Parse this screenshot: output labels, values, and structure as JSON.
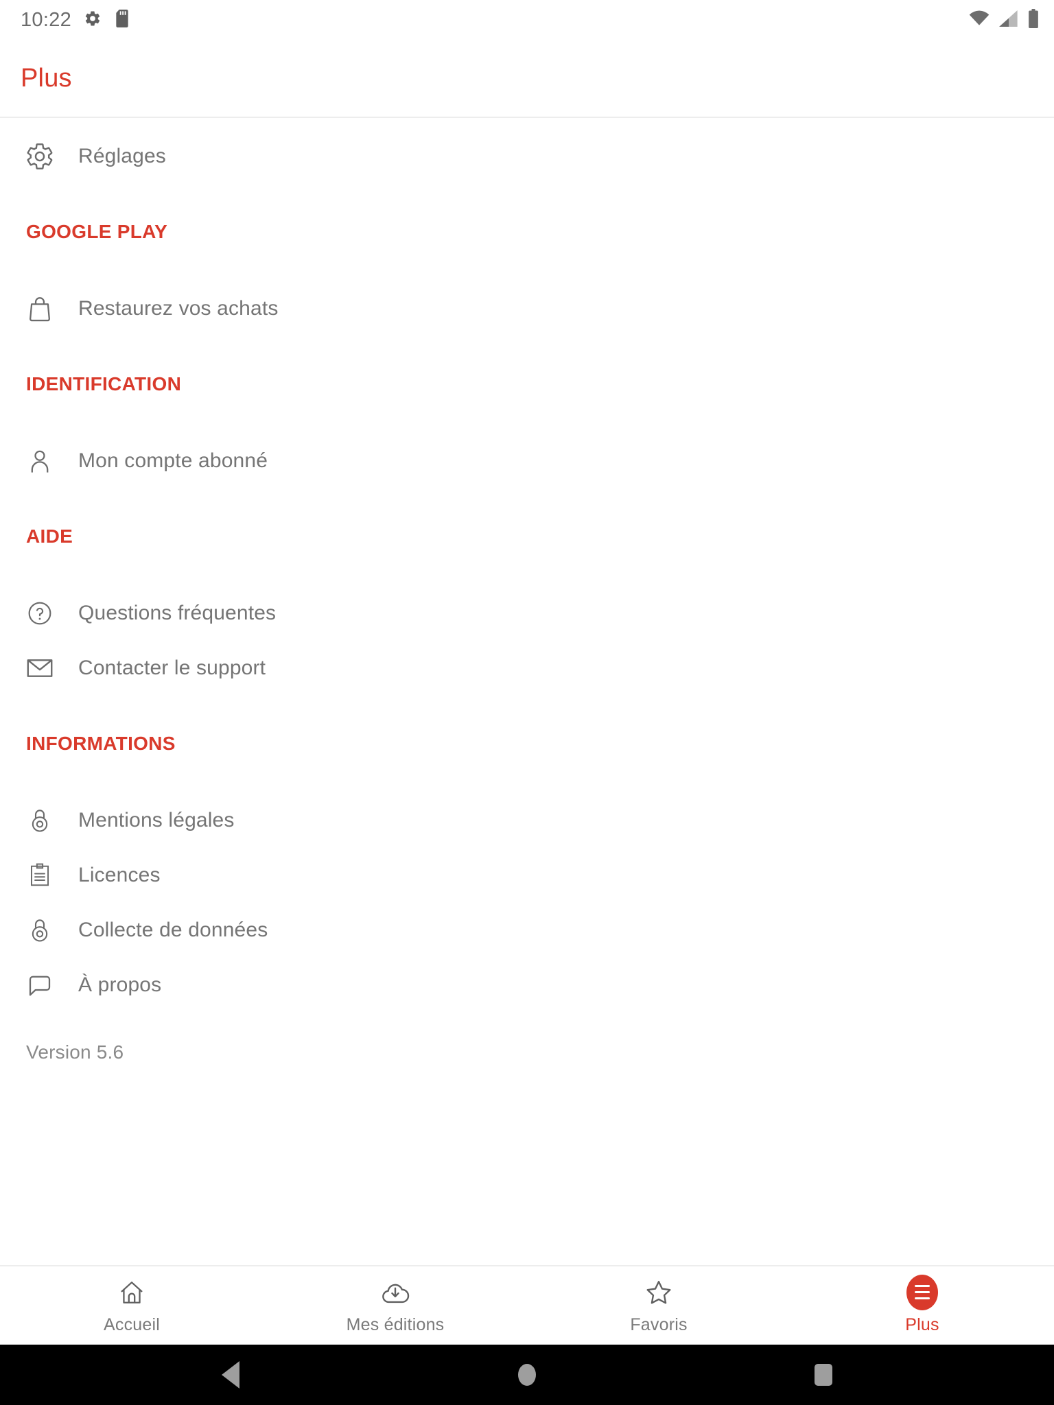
{
  "status_bar": {
    "time": "10:22",
    "left_icons": [
      "gear-icon",
      "sd-card-icon"
    ],
    "right_icons": [
      "wifi-icon",
      "cellular-signal-icon",
      "battery-icon"
    ]
  },
  "header": {
    "title": "Plus"
  },
  "colors": {
    "accent": "#d93a2b",
    "label": "#757575",
    "divider": "#ededed",
    "background": "#ffffff",
    "system_nav": "#000000"
  },
  "content": {
    "top_item": {
      "icon": "gear-icon",
      "label": "Réglages"
    },
    "sections": [
      {
        "title": "GOOGLE PLAY",
        "items": [
          {
            "icon": "shopping-bag-icon",
            "label": "Restaurez vos achats"
          }
        ]
      },
      {
        "title": "IDENTIFICATION",
        "items": [
          {
            "icon": "person-icon",
            "label": "Mon compte abonné"
          }
        ]
      },
      {
        "title": "AIDE",
        "items": [
          {
            "icon": "help-circle-icon",
            "label": "Questions fréquentes"
          },
          {
            "icon": "envelope-icon",
            "label": "Contacter le support"
          }
        ]
      },
      {
        "title": "INFORMATIONS",
        "items": [
          {
            "icon": "lock-icon",
            "label": "Mentions légales"
          },
          {
            "icon": "clipboard-icon",
            "label": "Licences"
          },
          {
            "icon": "lock-icon",
            "label": "Collecte de données"
          },
          {
            "icon": "speech-bubble-icon",
            "label": "À propos"
          }
        ]
      }
    ],
    "version": "Version 5.6"
  },
  "bottom_nav": {
    "items": [
      {
        "icon": "home-icon",
        "label": "Accueil",
        "active": false
      },
      {
        "icon": "cloud-download-icon",
        "label": "Mes éditions",
        "active": false
      },
      {
        "icon": "star-icon",
        "label": "Favoris",
        "active": false
      },
      {
        "icon": "hamburger-badge-icon",
        "label": "Plus",
        "active": true
      }
    ]
  },
  "system_nav": {
    "buttons": [
      "back-triangle-icon",
      "home-circle-icon",
      "recents-square-icon"
    ]
  }
}
